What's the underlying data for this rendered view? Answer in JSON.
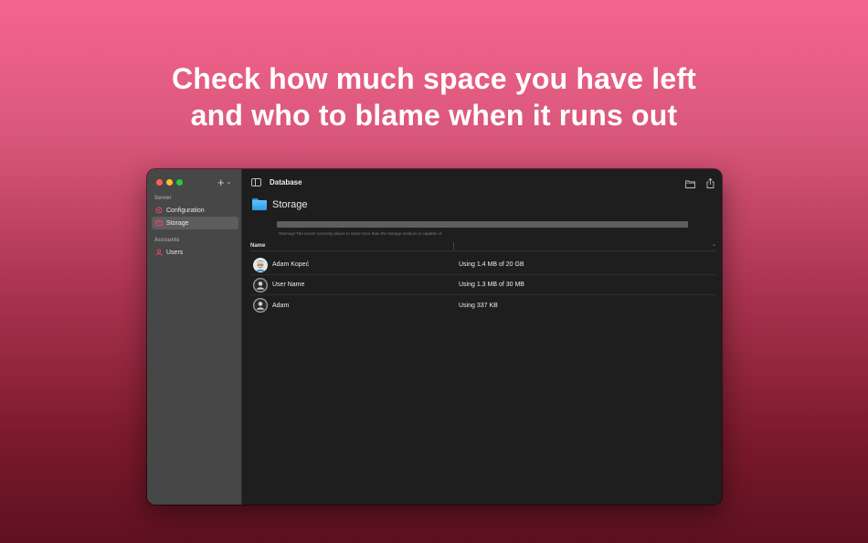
{
  "headline": {
    "line1": "Check how much space you have left",
    "line2": "and who to blame when it runs out"
  },
  "sidebar": {
    "sections": [
      {
        "label": "Server",
        "items": [
          {
            "label": "Configuration",
            "icon": "gear-icon",
            "selected": false
          },
          {
            "label": "Storage",
            "icon": "storage-icon",
            "selected": true
          }
        ]
      },
      {
        "label": "Accounts",
        "items": [
          {
            "label": "Users",
            "icon": "user-icon",
            "selected": false
          }
        ]
      }
    ],
    "add_label": "+"
  },
  "toolbar": {
    "title": "Database"
  },
  "storage": {
    "title": "Storage",
    "warning": "Warning! The server currently allows to store more than the storage medium is capable of.",
    "progress_fraction": 1.0
  },
  "table": {
    "columns": [
      "Name",
      ""
    ],
    "rows": [
      {
        "name": "Adam Kopeć",
        "usage": "Using 1.4 MB of 20 GB",
        "avatar": "memoji-avatar"
      },
      {
        "name": "User Name",
        "usage": "Using 1.3 MB of 30 MB",
        "avatar": "default-avatar"
      },
      {
        "name": "Adam",
        "usage": "Using 337 KB",
        "avatar": "default-avatar"
      }
    ]
  },
  "colors": {
    "accent": "#e9456f",
    "sidebar_bg": "#474748",
    "content_bg": "#1e1e1e"
  }
}
